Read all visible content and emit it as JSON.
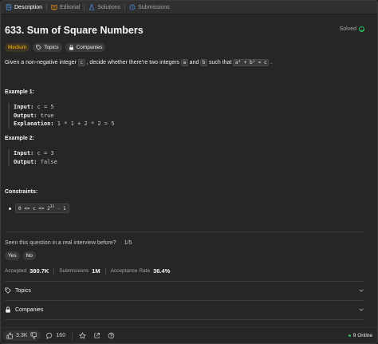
{
  "tabs": [
    {
      "label": "Description",
      "icon": "description-icon",
      "color": "#4a90e2"
    },
    {
      "label": "Editorial",
      "icon": "book-icon",
      "color": "#ffa116"
    },
    {
      "label": "Solutions",
      "icon": "flask-icon",
      "color": "#4a90e2"
    },
    {
      "label": "Submissions",
      "icon": "history-icon",
      "color": "#4a90e2"
    }
  ],
  "problem": {
    "title": "633. Sum of Square Numbers",
    "status": "Solved",
    "difficulty": "Medium",
    "topics_chip": "Topics",
    "companies_chip": "Companies",
    "desc_pre": "Given a non-negative integer",
    "desc_c": "c",
    "desc_mid": ", decide whether there're two integers",
    "desc_a": "a",
    "desc_and": "and",
    "desc_b": "b",
    "desc_post": "such that",
    "desc_eq": "a² + b² = c",
    "desc_end": "."
  },
  "examples": [
    {
      "title": "Example 1:",
      "input_label": "Input:",
      "input": "c = 5",
      "output_label": "Output:",
      "output": "true",
      "explanation_label": "Explanation:",
      "explanation": "1 * 1 + 2 * 2 = 5"
    },
    {
      "title": "Example 2:",
      "input_label": "Input:",
      "input": "c = 3",
      "output_label": "Output:",
      "output": "false"
    }
  ],
  "constraints": {
    "title": "Constraints:",
    "item_pre": "0 <= c <= 2",
    "item_sup": "31",
    "item_post": " - 1"
  },
  "interview": {
    "question": "Seen this question in a real interview before?",
    "pager": "1/5",
    "yes": "Yes",
    "no": "No"
  },
  "stats": {
    "accepted_label": "Accepted",
    "accepted_value": "380.7K",
    "submissions_label": "Submissions",
    "submissions_value": "1M",
    "rate_label": "Acceptance Rate",
    "rate_value": "36.4%"
  },
  "sections": {
    "topics": "Topics",
    "companies": "Companies"
  },
  "bottom": {
    "likes": "3.3K",
    "comments": "160",
    "online": "9 Online"
  }
}
